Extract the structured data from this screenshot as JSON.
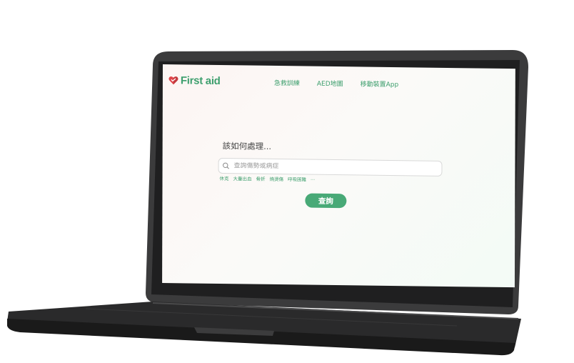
{
  "brand": {
    "name": "First aid",
    "logo_icon": "heart-icon"
  },
  "nav": {
    "items": [
      {
        "label": "急救訓練"
      },
      {
        "label": "AED地圖"
      },
      {
        "label": "移動裝置App"
      }
    ]
  },
  "main": {
    "heading": "該如何處理...",
    "search": {
      "placeholder": "查詢傷勢或病症",
      "value": ""
    },
    "tags": [
      "休克",
      "大量出血",
      "骨折",
      "燒燙傷",
      "呼吸困難",
      "..."
    ],
    "submit_label": "查詢"
  },
  "colors": {
    "brand_green": "#3e9f6e",
    "button_green": "#48a977",
    "logo_red": "#e0454a"
  }
}
